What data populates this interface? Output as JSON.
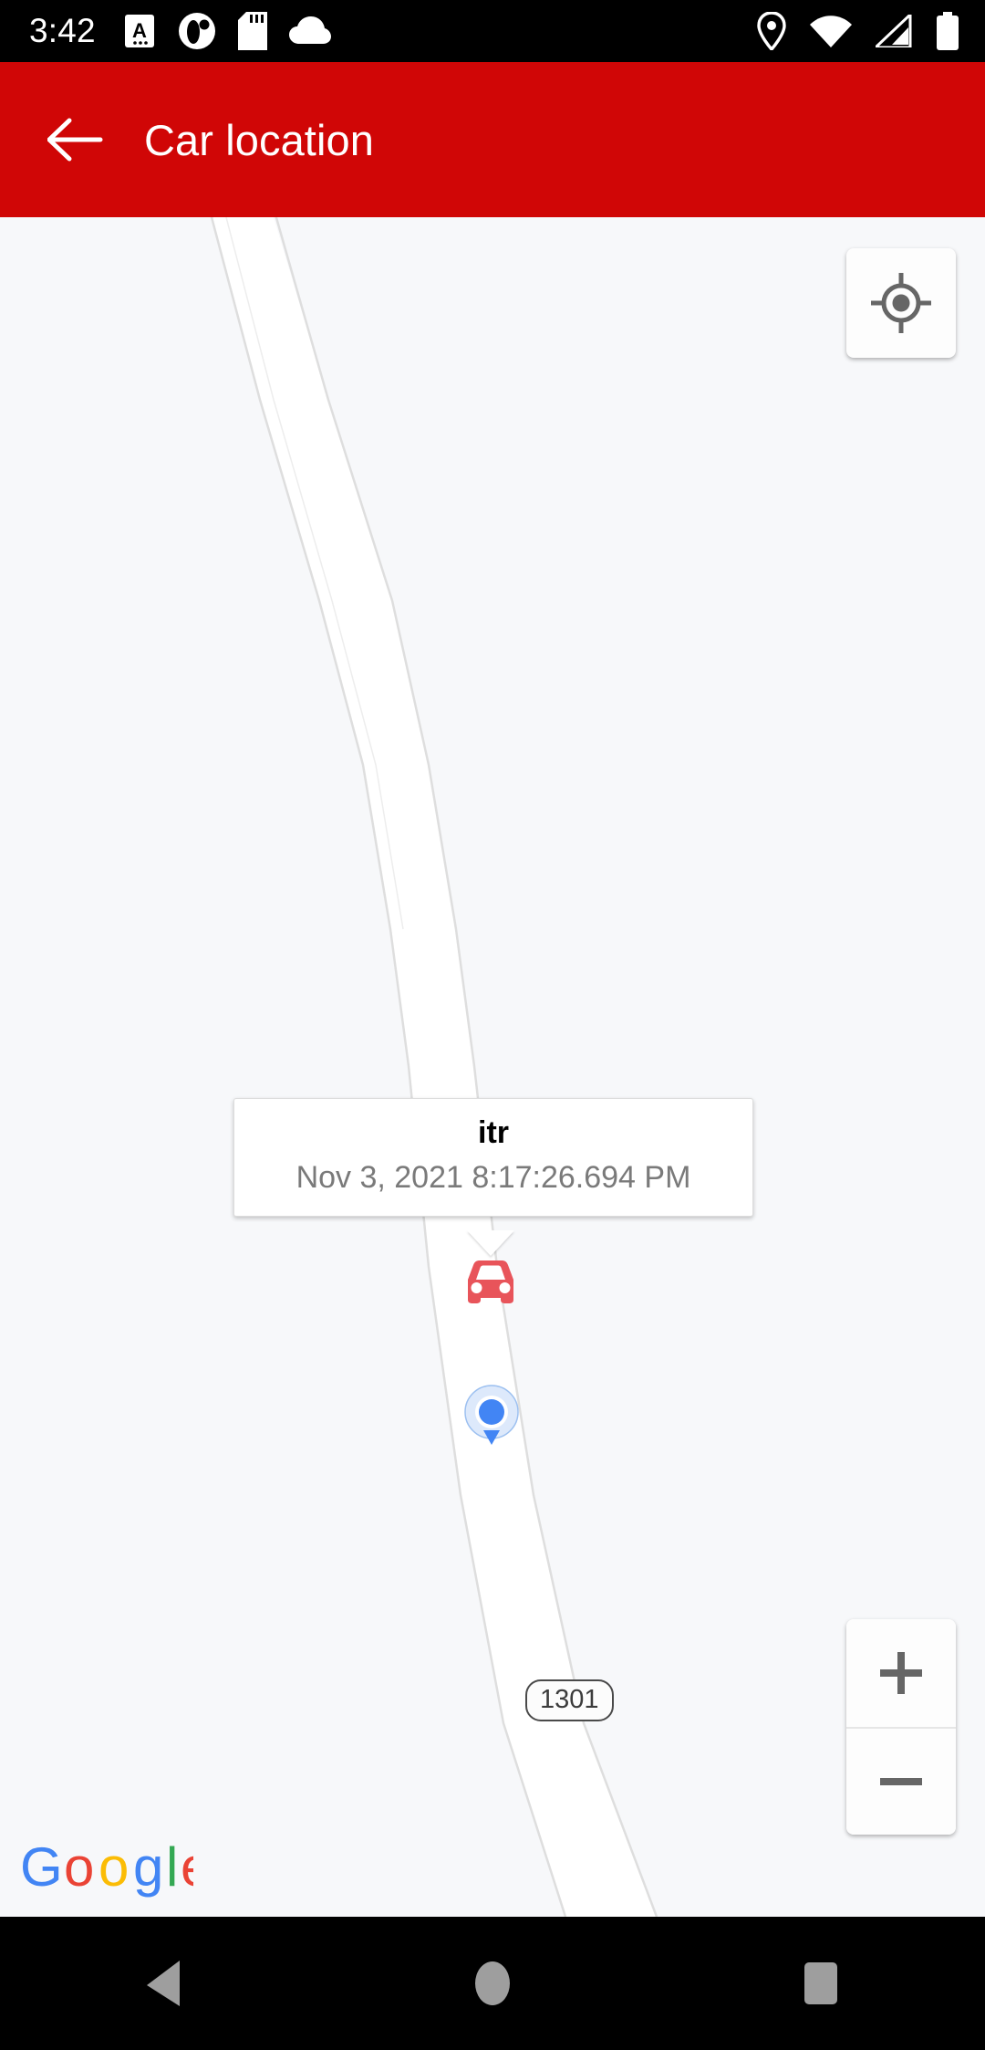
{
  "status_bar": {
    "time": "3:42",
    "left_icons": [
      "keyboard-a-icon",
      "app-circle-icon",
      "sd-card-icon",
      "cloud-icon"
    ],
    "right_icons": [
      "location-pin-icon",
      "wifi-icon",
      "cellular-signal-icon",
      "battery-icon"
    ],
    "background_color": "#000000"
  },
  "app_bar": {
    "back_label": "back-arrow",
    "title": "Car location",
    "background_color": "#D00606",
    "text_color": "#FFFFFF"
  },
  "map": {
    "background_color": "#F7F8FA",
    "road_color": "#FFFFFF",
    "road_border_color": "#DCDCDC",
    "road_shield_label": "1301",
    "attribution": "Google",
    "google_colors": {
      "blue": "#4285F4",
      "red": "#EA4335",
      "yellow": "#FBBC05",
      "green": "#34A853"
    },
    "my_location_button": "my-location-crosshair",
    "zoom_in_label": "+",
    "zoom_out_label": "−"
  },
  "info_window": {
    "title": "itr",
    "subtitle": "Nov 3, 2021 8:17:26.694 PM",
    "title_color": "#000000",
    "subtitle_color": "#7A7A7A",
    "background_color": "#FFFFFF"
  },
  "markers": {
    "car_marker": {
      "icon": "car-icon",
      "color": "#E8545A"
    },
    "user_location": {
      "icon": "user-location-dot",
      "dot_color": "#4285F4",
      "accuracy_color": "#CFE0F9"
    }
  },
  "nav_bar": {
    "back": "back-triangle",
    "home": "home-circle",
    "recents": "recents-square",
    "background_color": "#000000",
    "icon_color": "#9E9E9E"
  }
}
